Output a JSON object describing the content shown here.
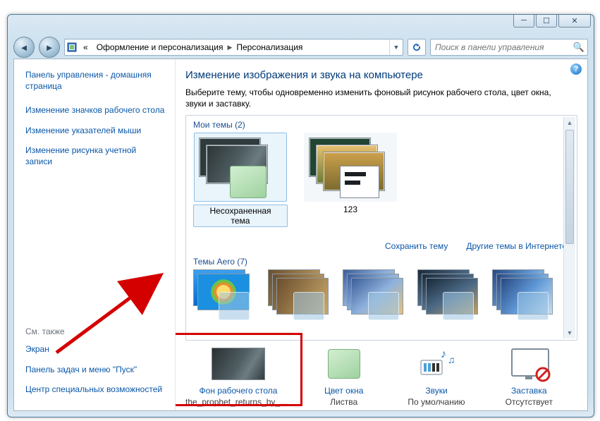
{
  "breadcrumb": {
    "back_chevrons": "«",
    "level1": "Оформление и персонализация",
    "level2": "Персонализация"
  },
  "search": {
    "placeholder": "Поиск в панели управления"
  },
  "sidebar": {
    "home": "Панель управления - домашняя страница",
    "links": [
      "Изменение значков рабочего стола",
      "Изменение указателей мыши",
      "Изменение рисунка учетной записи"
    ],
    "see_also_label": "См. также",
    "see_also": [
      "Экран",
      "Панель задач и меню \"Пуск\"",
      "Центр специальных возможностей"
    ]
  },
  "main": {
    "title": "Изменение изображения и звука на компьютере",
    "intro": "Выберите тему, чтобы одновременно изменить фоновый рисунок рабочего стола, цвет окна, звуки и заставку.",
    "group_my_themes": "Мои темы (2)",
    "group_aero": "Темы Aero (7)",
    "theme_unsaved": "Несохраненная тема",
    "theme_123": "123",
    "save_theme": "Сохранить тему",
    "more_online": "Другие темы в Интернете"
  },
  "settings": {
    "wallpaper": {
      "label": "Фон рабочего стола",
      "value": "the_prophet_returns_by_m..."
    },
    "color": {
      "label": "Цвет окна",
      "value": "Листва"
    },
    "sounds": {
      "label": "Звуки",
      "value": "По умолчанию"
    },
    "screensaver": {
      "label": "Заставка",
      "value": "Отсутствует"
    }
  }
}
